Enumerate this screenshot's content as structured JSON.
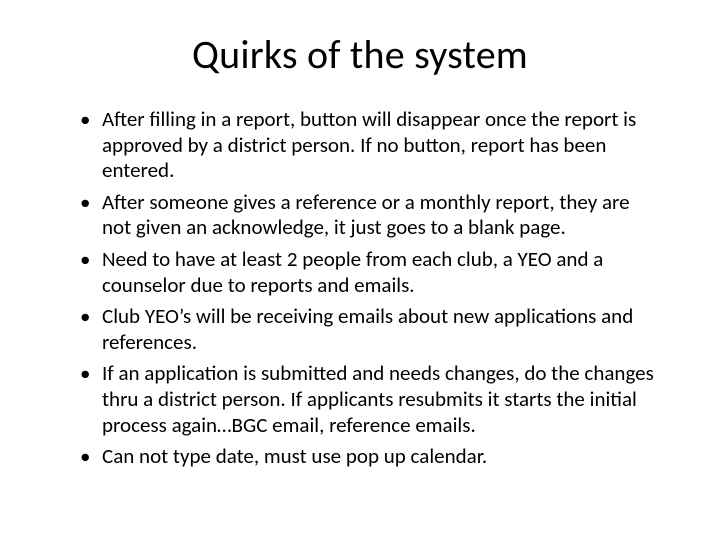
{
  "title": "Quirks of the system",
  "bullets": [
    "After filling in a report, button will disappear once the report is approved by a district person. If no button, report has been entered.",
    "After someone gives a reference or a monthly report, they are not given an acknowledge, it just goes to a blank page.",
    "Need to have at least 2 people from each club, a YEO and a counselor due to reports and emails.",
    "Club YEO’s will be receiving emails about new applications and references.",
    "If an application is submitted and needs changes, do the changes thru a district person.  If applicants resubmits it starts the initial process again…BGC email, reference emails.",
    "Can not type date, must use pop up calendar."
  ]
}
